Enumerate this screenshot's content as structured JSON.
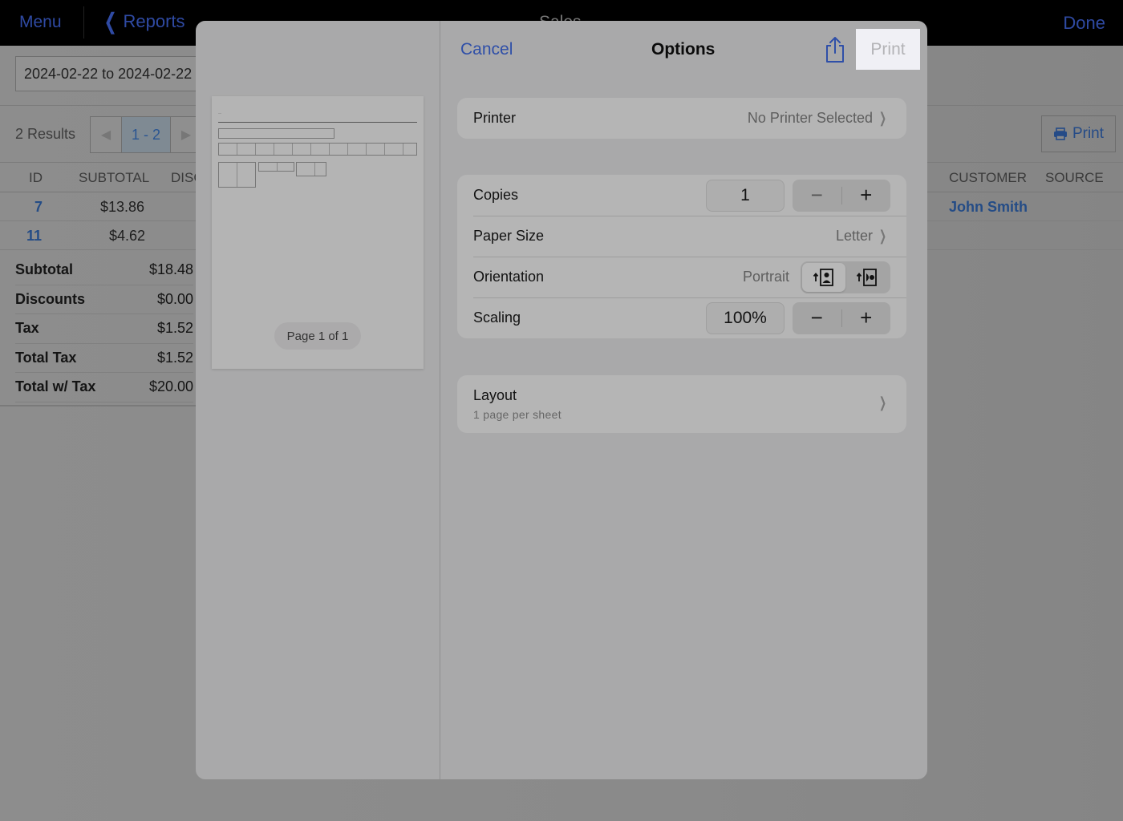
{
  "app": {
    "nav": {
      "menu_label": "Menu",
      "back_label": "Reports",
      "title": "Sales",
      "done_label": "Done"
    },
    "filter": {
      "date_range": "2024-02-22 to 2024-02-22"
    },
    "results": {
      "count_label": "2 Results",
      "page_range": "1 - 2",
      "print_label": "Print"
    },
    "table": {
      "columns": [
        "ID",
        "SUBTOTAL",
        "DISC",
        "CUSTOMER",
        "SOURCE"
      ],
      "rows": [
        {
          "id": "7",
          "subtotal": "$13.86",
          "customer": "John Smith"
        },
        {
          "id": "11",
          "subtotal": "$4.62",
          "customer": ""
        }
      ]
    },
    "summary": [
      {
        "label": "Subtotal",
        "value": "$18.48"
      },
      {
        "label": "Discounts",
        "value": "$0.00"
      },
      {
        "label": "Tax",
        "value": "$1.52"
      },
      {
        "label": "Total Tax",
        "value": "$1.52"
      },
      {
        "label": "Total w/ Tax",
        "value": "$20.00"
      }
    ]
  },
  "print_dialog": {
    "cancel_label": "Cancel",
    "title": "Options",
    "print_label": "Print",
    "share_icon": "share-icon",
    "preview": {
      "page_indicator": "Page 1 of 1"
    },
    "printer": {
      "label": "Printer",
      "value": "No Printer Selected"
    },
    "copies": {
      "label": "Copies",
      "value": "1",
      "minus": "−",
      "plus": "+"
    },
    "paper_size": {
      "label": "Paper Size",
      "value": "Letter"
    },
    "orientation": {
      "label": "Orientation",
      "value": "Portrait",
      "options": [
        "portrait",
        "landscape"
      ],
      "selected": "portrait"
    },
    "scaling": {
      "label": "Scaling",
      "value": "100%",
      "minus": "−",
      "plus": "+"
    },
    "layout": {
      "label": "Layout",
      "value": "1 page per sheet"
    }
  },
  "colors": {
    "accent": "#2f4fa8",
    "link": "#244c86"
  }
}
